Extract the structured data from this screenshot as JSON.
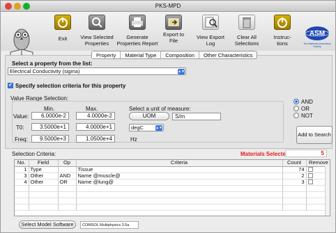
{
  "window": {
    "title": "PKS-MPD"
  },
  "toolbar": {
    "exit": "Exit",
    "view_selected_1": "View Selected",
    "view_selected_2": "Properties",
    "generate_1": "Generate",
    "generate_2": "Properties Report",
    "export_1": "Export to",
    "export_2": "File",
    "view_export_1": "View Export",
    "view_export_2": "Log",
    "clear_1": "Clear All",
    "clear_2": "Selections",
    "instr_1": "Instruc-",
    "instr_2": "tions",
    "logo_text": "ASM",
    "logo_sub": "The Materials Information Society"
  },
  "tabs": [
    "Property",
    "Material Type",
    "Composition",
    "Other Characteristics"
  ],
  "property": {
    "select_label": "Select a property from the list:",
    "selected": "Electrical Conductivity (sigma)"
  },
  "criteria": {
    "specify_label": "Specify selection criteria for this property",
    "checked": true,
    "value_range_label": "Value Range Selection:",
    "min_label": "Min.",
    "max_label": "Max.",
    "value_label": "Value:",
    "value_min": "6.0000e-2",
    "value_max": "4.0000e-2",
    "t0_label": "T0:",
    "t0_min": "3.5000e+1",
    "t0_max": "4.0000e+1",
    "freq_label": "Freq:",
    "freq_min": "9.5000e+3",
    "freq_max": "1.0500e+4",
    "uom_prompt": "Select a unit of measure:",
    "uom_button": "UOM",
    "uom_value": "S/m",
    "temp_unit": "degC",
    "freq_unit": "Hz"
  },
  "logic": {
    "and": "AND",
    "or": "OR",
    "not": "NOT",
    "selected": "AND",
    "add_button": "Add to Search"
  },
  "selection": {
    "label": "Selection Criteria:",
    "materials_selected_label": "Materials Selected :",
    "materials_selected_count": "5",
    "columns": [
      "No.",
      "Field",
      "Op",
      "Criteria",
      "Count",
      "Remove"
    ],
    "rows": [
      {
        "no": "1",
        "field": "Type",
        "op": "",
        "criteria": "Tissue",
        "count": "74"
      },
      {
        "no": "3",
        "field": "Other",
        "op": "AND",
        "criteria": "Name @muscle@",
        "count": "2"
      },
      {
        "no": "4",
        "field": "Other",
        "op": "OR",
        "criteria": "Name @lung@",
        "count": "3"
      }
    ]
  },
  "footer": {
    "model_button": "Select Model Software",
    "model_value": "COMSOL Multiphysics 3.5a"
  },
  "colors": {
    "accent": "#3b78de",
    "alert": "#e0201c"
  }
}
